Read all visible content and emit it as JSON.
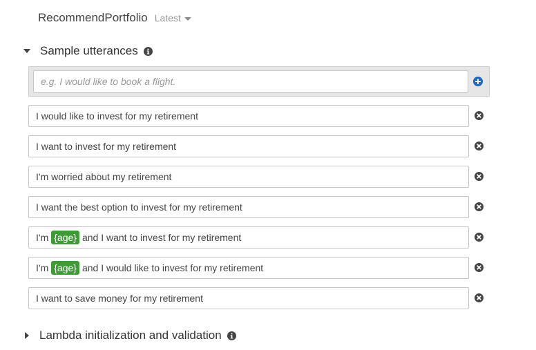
{
  "header": {
    "intent_name": "RecommendPortfolio",
    "version_label": "Latest"
  },
  "sample_utterances": {
    "title": "Sample utterances",
    "expanded": true,
    "new_input_placeholder": "e.g. I would like to book a flight.",
    "items": [
      {
        "text": "I would like to invest for my retirement"
      },
      {
        "text": "I want to invest for my retirement"
      },
      {
        "text": "I'm worried about my retirement"
      },
      {
        "text": "I want the best option to invest for my retirement"
      },
      {
        "prefix": "I'm",
        "slot": "{age}",
        "suffix": "and I want to invest for my retirement"
      },
      {
        "prefix": "I'm",
        "slot": "{age}",
        "suffix": "and I would like to invest for my retirement"
      },
      {
        "text": "I want to save money for my retirement"
      }
    ]
  },
  "lambda_section": {
    "title": "Lambda initialization and validation",
    "expanded": false
  },
  "icons": {
    "info": "info-icon",
    "add": "plus-circle-icon",
    "remove": "x-circle-icon",
    "expand": "caret-down-icon",
    "collapse": "caret-right-icon"
  },
  "colors": {
    "slot_bg": "#3d9c36",
    "add_icon": "#1f66c1",
    "remove_icon": "#444444"
  }
}
